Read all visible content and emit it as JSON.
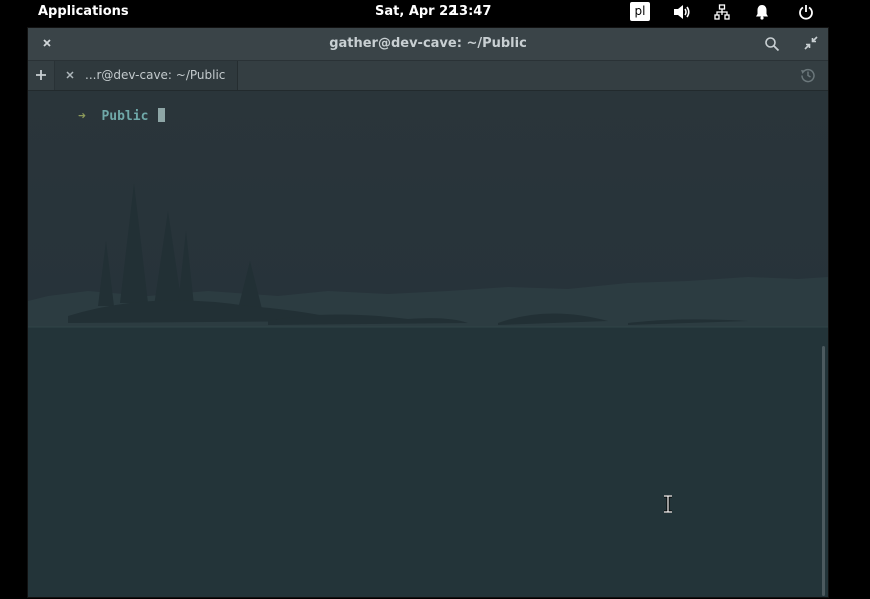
{
  "topbar": {
    "applications_label": "Applications",
    "date": "Sat, Apr 22",
    "time": "13:47",
    "keyboard_layout": "pl",
    "indicators": [
      "volume-icon",
      "network-icon",
      "notifications-icon",
      "power-icon"
    ]
  },
  "window": {
    "title": "gather@dev-cave: ~/Public",
    "icons": [
      "close-icon",
      "search-icon",
      "restore-icon"
    ]
  },
  "tabs": {
    "new_tab_icon": "plus-icon",
    "history_icon": "history-icon",
    "items": [
      {
        "label": "...r@dev-cave: ~/Public",
        "active": true
      }
    ]
  },
  "terminal": {
    "prompt_symbol": "➜",
    "current_dir": "Public",
    "colors": {
      "prompt_symbol": "#8c9a5a",
      "current_dir": "#6fa8a8",
      "background": "#2b3438"
    }
  }
}
